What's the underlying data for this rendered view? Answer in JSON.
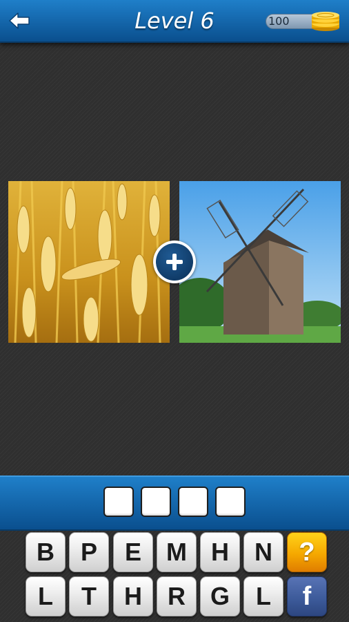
{
  "header": {
    "title": "Level 6",
    "coins": "100",
    "back_icon": "arrow-left-icon",
    "coin_icon": "coin-stack-icon"
  },
  "pictures": {
    "left": "wheat-field-photo",
    "right": "windmill-photo",
    "combine_icon": "plus-icon"
  },
  "answer": {
    "slots": [
      "",
      "",
      "",
      ""
    ]
  },
  "keyboard": {
    "row1": [
      "B",
      "P",
      "E",
      "M",
      "H",
      "N"
    ],
    "row2": [
      "L",
      "T",
      "H",
      "R",
      "G",
      "L"
    ],
    "hint_label": "?",
    "share_label": "f"
  },
  "colors": {
    "bar_blue": "#1f7fc9",
    "bar_dark": "#0a4f8e",
    "hint_orange": "#f5a800",
    "facebook_blue": "#3b5998"
  }
}
